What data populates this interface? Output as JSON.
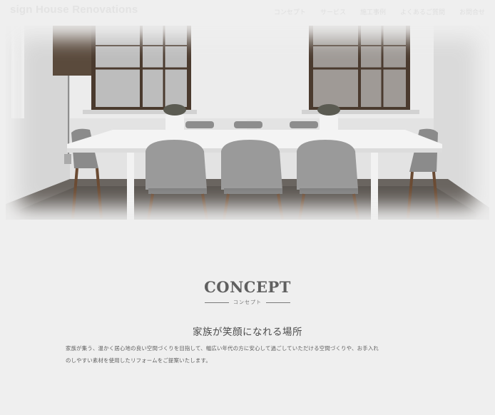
{
  "header": {
    "logo_text": "sign House Renovations",
    "nav": [
      {
        "label": "コンセプト",
        "icon": null
      },
      {
        "label": "サービス",
        "icon": null
      },
      {
        "label": "施工事例",
        "icon": null
      },
      {
        "label": "よくあるご質問",
        "icon": null
      },
      {
        "label": "お問合せ",
        "icon": null
      }
    ]
  },
  "hero": {
    "image_subject": "interior-dining-room-photo"
  },
  "concept": {
    "title": "CONCEPT",
    "subtitle": "コンセプト",
    "headline": "家族が笑顔になれる場所",
    "body_line1": "家族が集う、温かく居心地の良い空間づくりを目指して、幅広い年代の方に安心して過ごしていただける空間づくりや、お手入れ",
    "body_line2": "のしやすい素材を使用したリフォームをご提案いたします。"
  },
  "colors": {
    "page_bg": "#efefef",
    "title": "#5f5f5f",
    "text": "#5e5e5e"
  }
}
